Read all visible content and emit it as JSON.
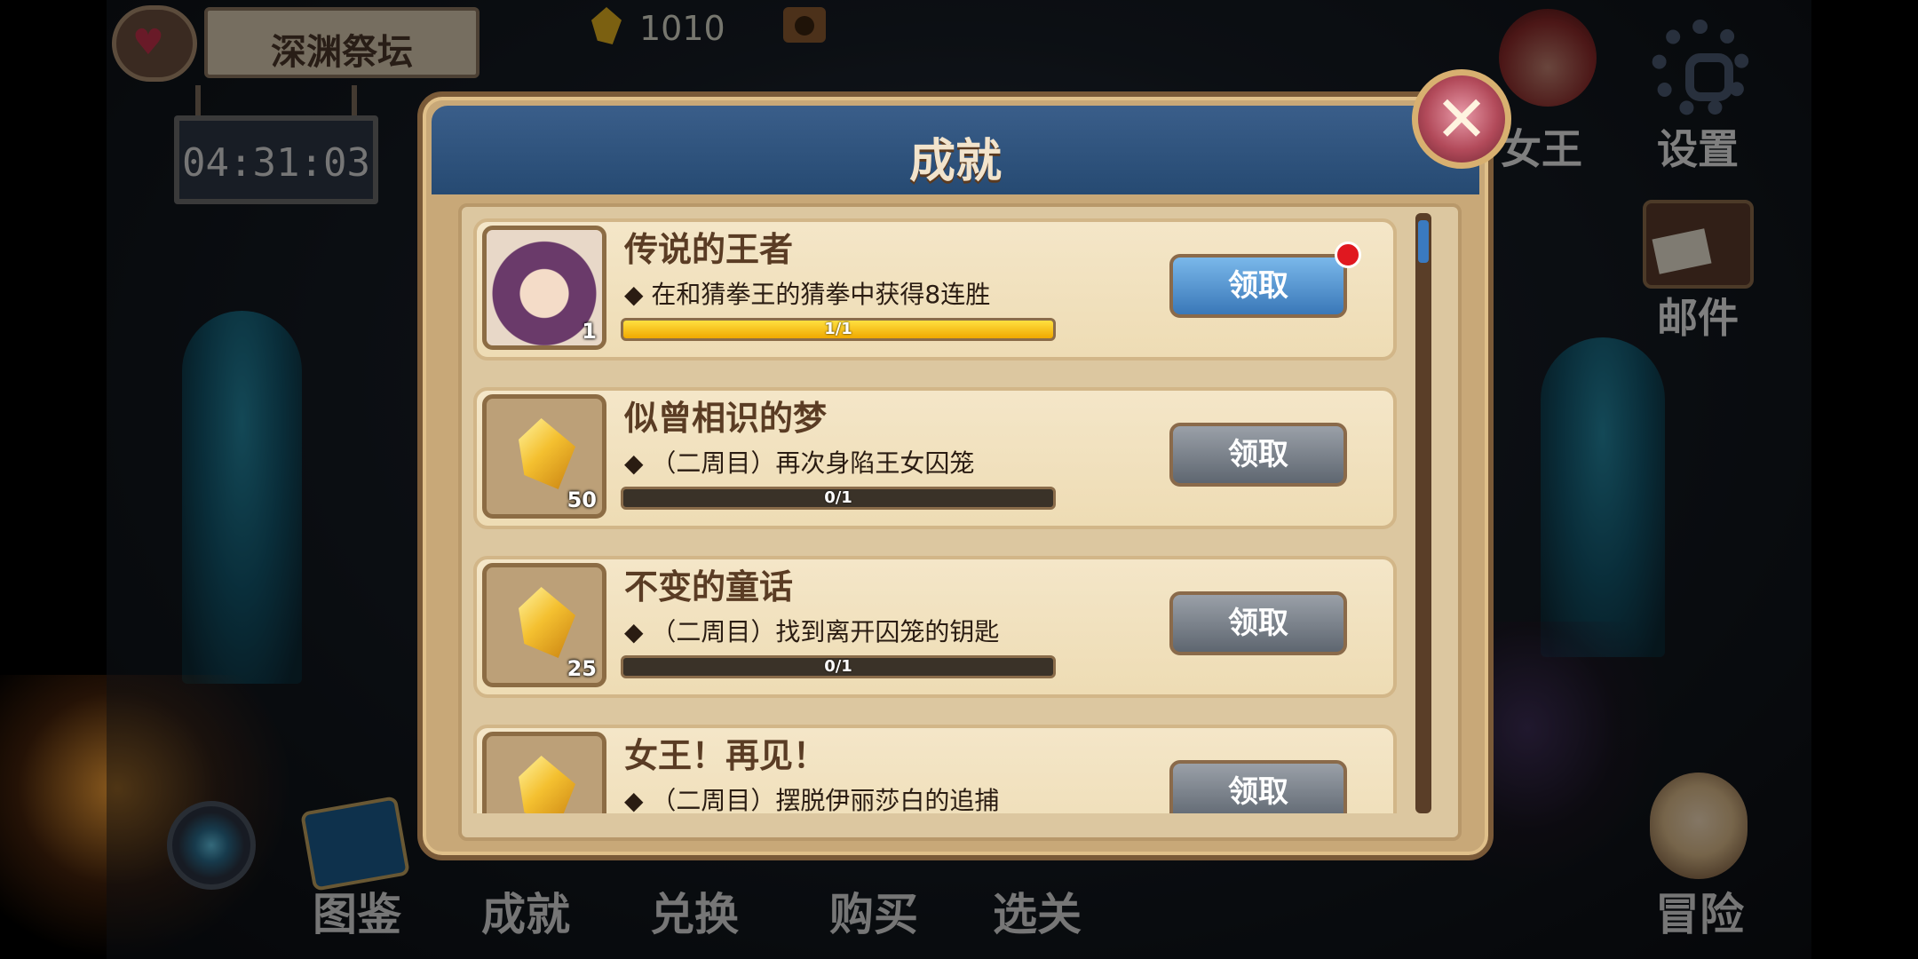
{
  "hud": {
    "location_title": "深渊祭坛",
    "timer": "04:31:03",
    "gem_count": "1010"
  },
  "side_menu": {
    "queen_label": "女王",
    "settings_label": "设置",
    "mail_label": "邮件"
  },
  "bottom_menu": {
    "atlas_label": "图鉴",
    "achievement_label": "成就",
    "exchange_label": "兑换",
    "buy_label": "购买",
    "stage_label": "选关",
    "adventure_label": "冒险"
  },
  "dialog": {
    "title": "成就",
    "achievements": [
      {
        "title": "传说的王者",
        "desc": "◆ 在和猜拳王的猜拳中获得8连胜",
        "reward": "portrait",
        "reward_qty": "1",
        "progress_text": "1/1",
        "progress": 1.0,
        "claim_label": "领取",
        "claimable": true
      },
      {
        "title": "似曾相识的梦",
        "desc": "◆ （二周目）再次身陷王女囚笼",
        "reward": "gem",
        "reward_qty": "50",
        "progress_text": "0/1",
        "progress": 0.0,
        "claim_label": "领取",
        "claimable": false
      },
      {
        "title": "不变的童话",
        "desc": "◆ （二周目）找到离开囚笼的钥匙",
        "reward": "gem",
        "reward_qty": "25",
        "progress_text": "0/1",
        "progress": 0.0,
        "claim_label": "领取",
        "claimable": false
      },
      {
        "title": "女王！再见！",
        "desc": "◆ （二周目）摆脱伊丽莎白的追捕",
        "reward": "gem",
        "reward_qty": "",
        "progress_text": "",
        "progress": 0.0,
        "claim_label": "领取",
        "claimable": false
      }
    ]
  },
  "colors": {
    "claim_active": "#3a78b8",
    "claim_inactive": "#5e6670",
    "progress_fill": "#f0a800",
    "notification": "#e01820"
  }
}
